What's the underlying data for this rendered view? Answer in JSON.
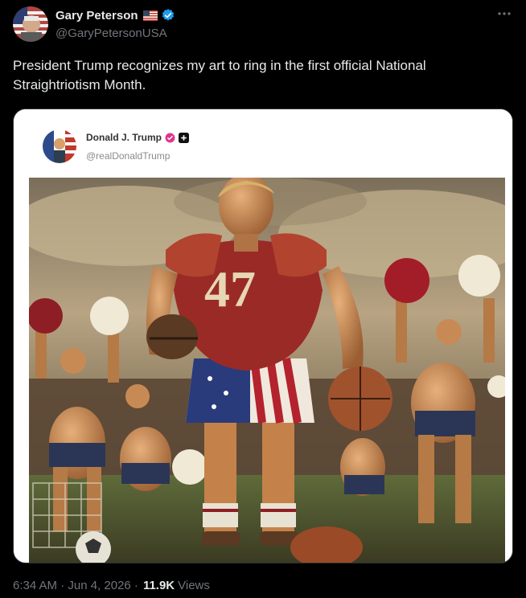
{
  "author": {
    "name": "Gary Peterson",
    "handle": "@GaryPetersonUSA",
    "flag_icon": "us-flag-icon",
    "verified_icon": "verified-badge-icon",
    "verified_color": "#1d9bf0"
  },
  "more_icon": "more-options-icon",
  "tweet": {
    "text": "President Trump recognizes my art to ring in the first official National Straightriotism Month."
  },
  "embedded_post": {
    "name": "Donald J. Trump",
    "handle": "@realDonaldTrump",
    "badge_color": "#e0368c",
    "badges": [
      "verified-badge-icon",
      "plus-badge-icon"
    ],
    "jersey_number": "47"
  },
  "footer": {
    "time": "6:34 AM · Jun 4, 2026 ·",
    "views_count": "11.9K",
    "views_label": "Views"
  }
}
